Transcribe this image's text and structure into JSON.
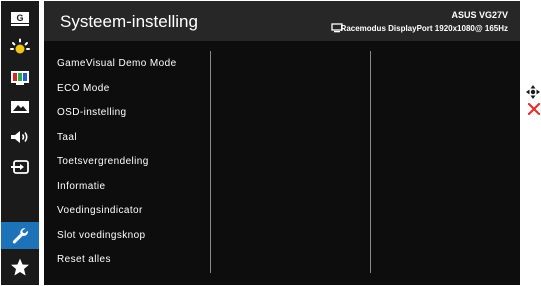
{
  "sidebar": {
    "items": [
      {
        "name": "gamevisual",
        "icon": "gamevisual-icon",
        "glyph": "G"
      },
      {
        "name": "blue-light-filter",
        "icon": "brightness-icon"
      },
      {
        "name": "color",
        "icon": "color-bars-icon"
      },
      {
        "name": "image",
        "icon": "image-icon"
      },
      {
        "name": "sound",
        "icon": "speaker-icon"
      },
      {
        "name": "input",
        "icon": "input-select-icon"
      },
      {
        "name": "system-setup",
        "icon": "wrench-icon",
        "active": true
      },
      {
        "name": "favorites",
        "icon": "star-icon"
      }
    ],
    "active_color": "#1e73b8"
  },
  "header": {
    "title": "Systeem-instelling",
    "model": "ASUS  VG27V",
    "status": "Racemodus  DisplayPort  1920x1080@  165Hz"
  },
  "menu": {
    "items": [
      "GameVisual Demo Mode",
      "ECO Mode",
      "OSD-instelling",
      "Taal",
      "Toetsvergrendeling",
      "Informatie",
      "Voedingsindicator",
      "Slot voedingsknop",
      "Reset alles"
    ]
  },
  "hints": {
    "navigate": "joystick-icon",
    "exit": "close-icon",
    "exit_color": "#e03030"
  }
}
